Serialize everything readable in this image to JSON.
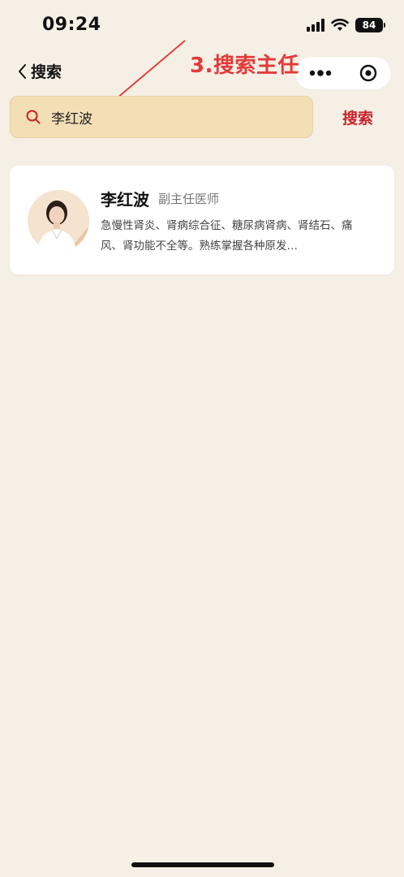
{
  "status_bar": {
    "time": "09:24",
    "battery": "84"
  },
  "nav": {
    "back_label": "搜索"
  },
  "annotation": {
    "text": "3.搜索主任"
  },
  "search": {
    "query": "李红波",
    "button_label": "搜索"
  },
  "result": {
    "name": "李红波",
    "title": "副主任医师",
    "description": "急慢性肾炎、肾病综合征、糖尿病肾病、肾结石、痛风、肾功能不全等。熟练掌握各种原发…"
  },
  "colors": {
    "background": "#f5efe5",
    "accent": "#c8232c",
    "search_bg": "#f3dfb6",
    "annotation": "#e23a3a"
  }
}
